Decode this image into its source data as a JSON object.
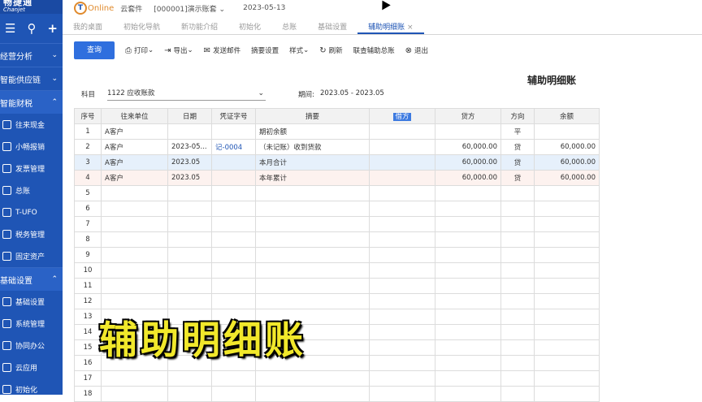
{
  "sidebar": {
    "logo_cn": "畅捷通",
    "logo_en": "Chanjet",
    "groups": [
      "经营分析",
      "智能供应链",
      "智能财税",
      "基础设置"
    ],
    "finance_items": [
      "往来现金",
      "小畅报销",
      "发票管理",
      "总账",
      "T-UFO",
      "税务管理",
      "固定资产"
    ],
    "setup_items": [
      "基础设置",
      "系统管理",
      "协同办公",
      "云应用",
      "初始化"
    ]
  },
  "header": {
    "logo_online": "Online",
    "product": "云套件",
    "account": "[000001]演示账套",
    "date": "2023-05-13"
  },
  "tabs": [
    "我的桌面",
    "初始化导航",
    "新功能介绍",
    "初始化",
    "总账",
    "基础设置",
    "辅助明细账"
  ],
  "toolbar": {
    "query": "查询",
    "print": "打印",
    "export": "导出",
    "mail": "发送邮件",
    "summary": "摘要设置",
    "style": "样式",
    "refresh": "刷新",
    "link": "联查辅助总账",
    "exit": "退出"
  },
  "report": {
    "title": "辅助明细账",
    "subject_label": "科目",
    "subject_value": "1122 应收账款",
    "period_label": "期间:",
    "period_value": "2023.05 - 2023.05"
  },
  "table": {
    "headers": [
      "序号",
      "往来单位",
      "日期",
      "凭证字号",
      "摘要",
      "借方",
      "贷方",
      "方向",
      "余额"
    ],
    "rows": [
      [
        "1",
        "A客户",
        "",
        "",
        "期初余额",
        "",
        "",
        "平",
        ""
      ],
      [
        "2",
        "A客户",
        "2023-05...",
        "记-0004",
        "（未记账）收到货款",
        "",
        "60,000.00",
        "贷",
        "60,000.00"
      ],
      [
        "3",
        "A客户",
        "2023.05",
        "",
        "本月合计",
        "",
        "60,000.00",
        "贷",
        "60,000.00"
      ],
      [
        "4",
        "A客户",
        "2023.05",
        "",
        "本年累计",
        "",
        "60,000.00",
        "贷",
        "60,000.00"
      ],
      [
        "5",
        "",
        "",
        "",
        "",
        "",
        "",
        "",
        ""
      ],
      [
        "6",
        "",
        "",
        "",
        "",
        "",
        "",
        "",
        ""
      ],
      [
        "7",
        "",
        "",
        "",
        "",
        "",
        "",
        "",
        ""
      ],
      [
        "8",
        "",
        "",
        "",
        "",
        "",
        "",
        "",
        ""
      ],
      [
        "9",
        "",
        "",
        "",
        "",
        "",
        "",
        "",
        ""
      ],
      [
        "10",
        "",
        "",
        "",
        "",
        "",
        "",
        "",
        ""
      ],
      [
        "11",
        "",
        "",
        "",
        "",
        "",
        "",
        "",
        ""
      ],
      [
        "12",
        "",
        "",
        "",
        "",
        "",
        "",
        "",
        ""
      ],
      [
        "13",
        "",
        "",
        "",
        "",
        "",
        "",
        "",
        ""
      ],
      [
        "14",
        "",
        "",
        "",
        "",
        "",
        "",
        "",
        ""
      ],
      [
        "15",
        "",
        "",
        "",
        "",
        "",
        "",
        "",
        ""
      ],
      [
        "16",
        "",
        "",
        "",
        "",
        "",
        "",
        "",
        ""
      ],
      [
        "17",
        "",
        "",
        "",
        "",
        "",
        "",
        "",
        ""
      ],
      [
        "18",
        "",
        "",
        "",
        "",
        "",
        "",
        "",
        ""
      ]
    ]
  },
  "overlay_text": "辅助明细账"
}
